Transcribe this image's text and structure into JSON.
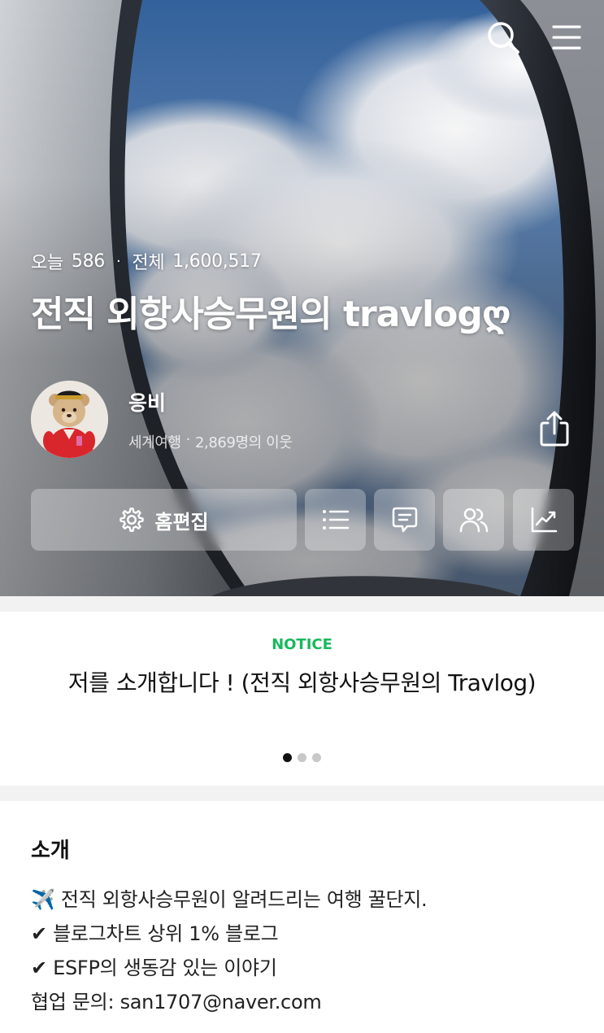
{
  "header": {
    "search_icon": "search-icon",
    "menu_icon": "hamburger-menu-icon"
  },
  "stats": {
    "today_label": "오늘",
    "today_count": "586",
    "separator": "·",
    "total_label": "전체",
    "total_count": "1,600,517"
  },
  "blog": {
    "title": "전직 외항사승무원의 travlogღ",
    "nickname": "응비",
    "category": "세계여행",
    "meta_separator": "·",
    "neighbors": "2,869명의 이웃"
  },
  "actions": {
    "home_edit_label": "홈편집",
    "icons": [
      "gear-icon",
      "list-icon",
      "chat-icon",
      "neighbors-icon",
      "stats-icon",
      "share-icon"
    ]
  },
  "notice": {
    "label": "NOTICE",
    "title": "저를 소개합니다 ! (전직 외항사승무원의 Travlog)",
    "pages": 3,
    "current_page": 1,
    "accent_color": "#19b85c"
  },
  "intro": {
    "heading": "소개",
    "lines": [
      "✈️ 전직 외항사승무원이 알려드리는 여행 꿀단지.",
      "✔ 블로그차트 상위 1% 블로그",
      "✔ ESFP의 생동감 있는 이야기",
      "협업 문의: san1707@naver.com"
    ]
  }
}
